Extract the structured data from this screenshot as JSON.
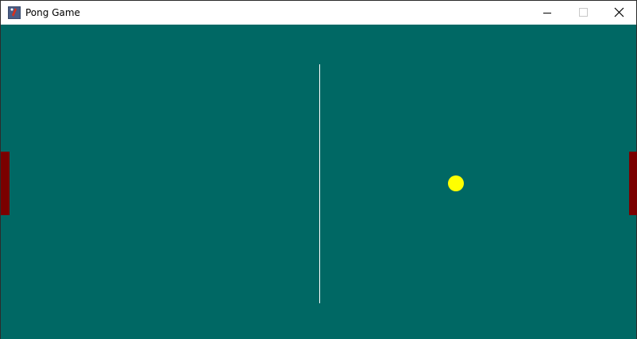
{
  "window": {
    "title": "Pong Game",
    "icon": "pong-app-icon",
    "controls": [
      "minimize-icon",
      "maximize-icon",
      "close-icon"
    ]
  },
  "game": {
    "background_color": "#006864",
    "net_color": "#ffffff",
    "paddle_color": "#7a0000",
    "ball_color": "#ffff00"
  }
}
